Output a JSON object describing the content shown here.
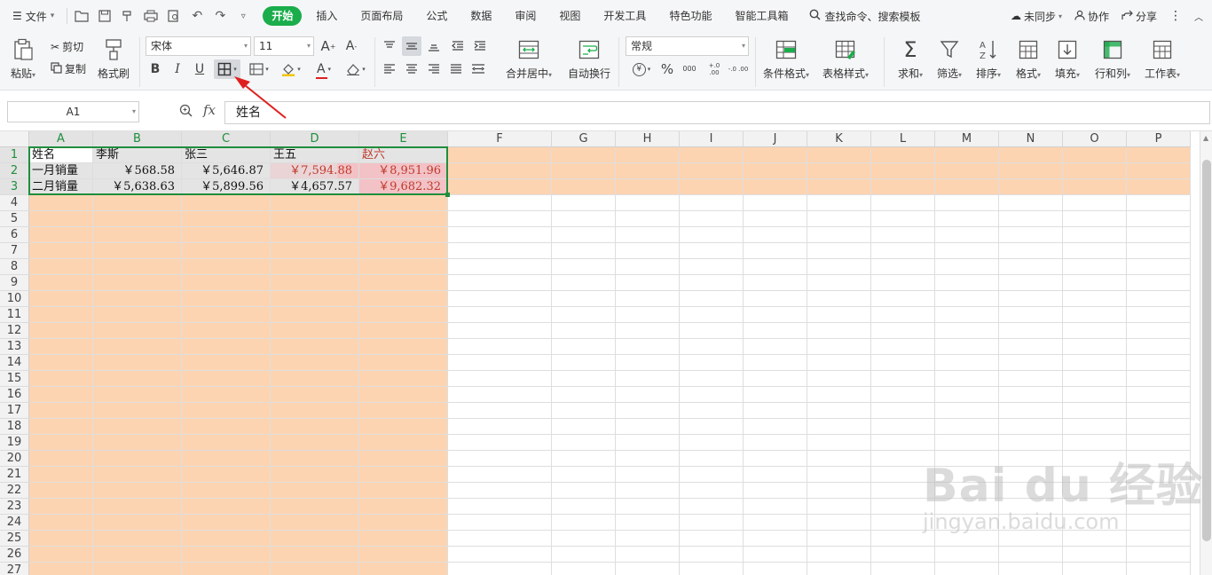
{
  "menu": {
    "file_label": "文件",
    "tabs": [
      {
        "label": "开始",
        "active": true
      },
      {
        "label": "插入",
        "active": false
      },
      {
        "label": "页面布局",
        "active": false
      },
      {
        "label": "公式",
        "active": false
      },
      {
        "label": "数据",
        "active": false
      },
      {
        "label": "审阅",
        "active": false
      },
      {
        "label": "视图",
        "active": false
      },
      {
        "label": "开发工具",
        "active": false
      },
      {
        "label": "特色功能",
        "active": false
      },
      {
        "label": "智能工具箱",
        "active": false
      }
    ],
    "search_label": "查找命令、搜索模板",
    "sync_label": "未同步",
    "collab_label": "协作",
    "share_label": "分享"
  },
  "ribbon": {
    "paste": "粘贴",
    "cut": "剪切",
    "copy": "复制",
    "format_painter": "格式刷",
    "font_name": "宋体",
    "font_size": "11",
    "merge_center": "合并居中",
    "wrap_text": "自动换行",
    "number_format": "常规",
    "conditional_format": "条件格式",
    "table_style": "表格样式",
    "sum": "求和",
    "filter": "筛选",
    "sort": "排序",
    "format": "格式",
    "fill": "填充",
    "row_col": "行和列",
    "worksheet": "工作表",
    "currency_symbol": "¥",
    "percent_symbol": "%",
    "thousands_symbol": "000",
    "inc_decimal": "+.0 .00",
    "dec_decimal": "-.0 .00",
    "bold": "B",
    "italic": "I",
    "underline": "U",
    "font_color_letter": "A",
    "font_grow": "A",
    "font_shrink": "A"
  },
  "formula_bar": {
    "name_box": "A1",
    "fx": "fx",
    "content": "姓名"
  },
  "sheet": {
    "columns": [
      "A",
      "B",
      "C",
      "D",
      "E",
      "F",
      "G",
      "H",
      "I",
      "J",
      "K",
      "L",
      "M",
      "N",
      "O",
      "P"
    ],
    "rows": [
      "1",
      "2",
      "3",
      "4",
      "5",
      "6",
      "7",
      "8",
      "9",
      "10",
      "11",
      "12",
      "13",
      "14",
      "15",
      "16",
      "17",
      "18",
      "19",
      "20",
      "21",
      "22",
      "23",
      "24",
      "25",
      "26",
      "27"
    ],
    "cells": [
      [
        "姓名",
        "李斯",
        "张三",
        "王五",
        "赵六"
      ],
      [
        "一月销量",
        "￥568.58",
        "￥5,646.87",
        "￥7,594.88",
        "￥8,951.96"
      ],
      [
        "二月销量",
        "￥5,638.63",
        "￥5,899.56",
        "￥4,657.57",
        "￥9,682.32"
      ]
    ]
  },
  "colors": {
    "accent": "#1aad4b",
    "selection_border": "#1f8e3c",
    "highlight_orange": "#fdd4b1",
    "highlight_red": "#f2c2c6",
    "red_text": "#c0392b",
    "arrow": "#e02020"
  },
  "watermark": {
    "main": "Bai du 经验",
    "sub": "jingyan.baidu.com"
  }
}
